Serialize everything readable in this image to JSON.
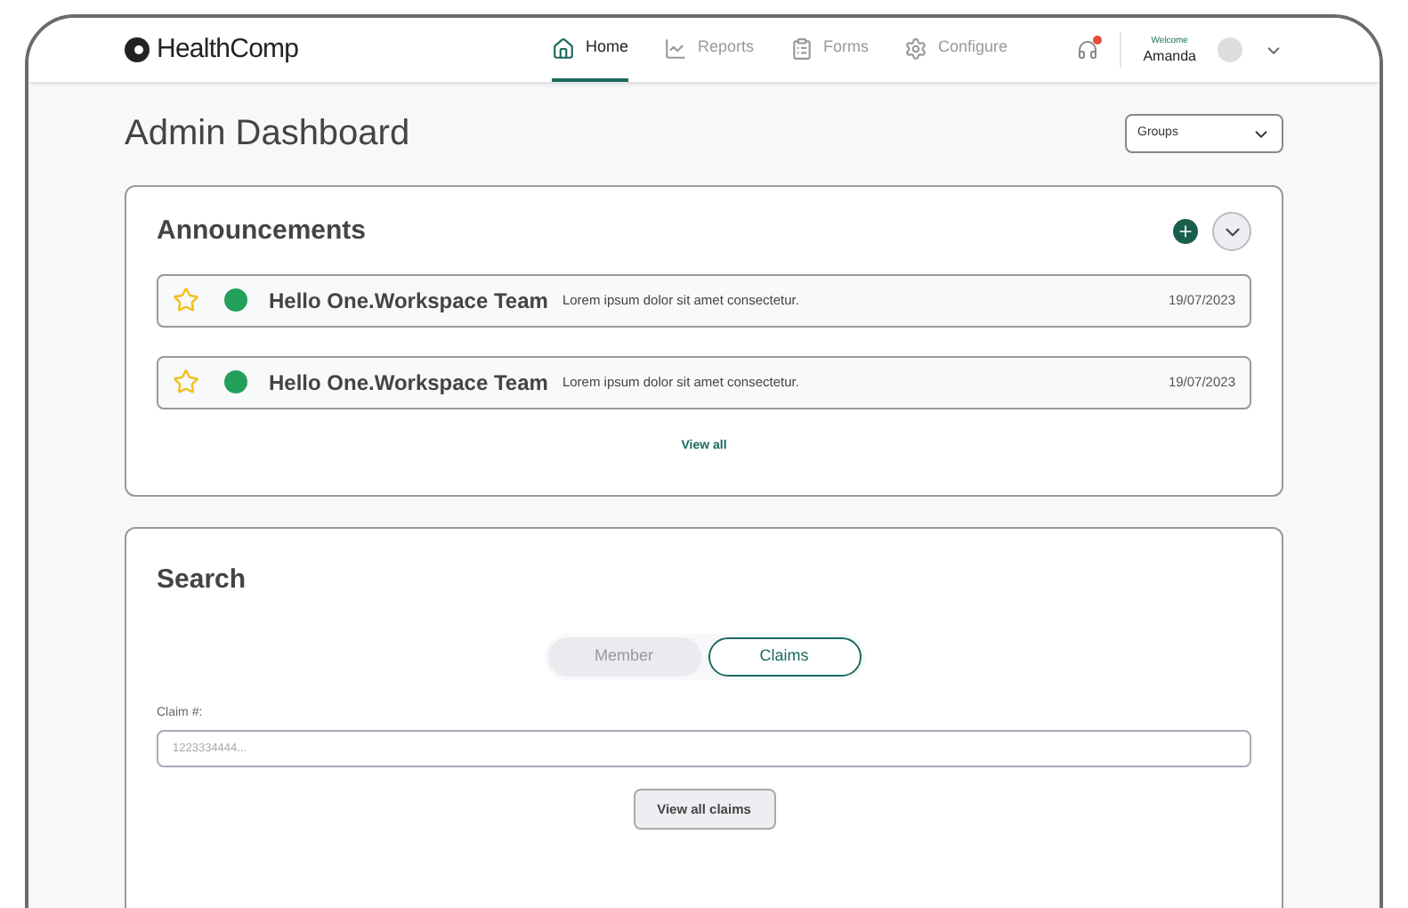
{
  "header": {
    "logo": "HealthComp",
    "nav": [
      {
        "label": "Home",
        "selected": true
      },
      {
        "label": "Reports",
        "selected": false
      },
      {
        "label": "Forms",
        "selected": false
      },
      {
        "label": "Configure",
        "selected": false
      }
    ],
    "welcome": "Welcome",
    "user": "Amanda"
  },
  "page": {
    "title": "Admin Dashboard",
    "groups_dropdown": "Groups"
  },
  "announcements": {
    "title": "Announcements",
    "items": [
      {
        "title": "Hello One.Workspace Team",
        "text": "Lorem ipsum dolor sit amet consectetur.",
        "date": "19/07/2023",
        "color": "#22a05a"
      },
      {
        "title": "Hello One.Workspace Team",
        "text": "Lorem ipsum dolor sit amet consectetur.",
        "date": "19/07/2023",
        "color": "#22a05a"
      }
    ],
    "view_all": "View all"
  },
  "search": {
    "title": "Search",
    "tabs": [
      {
        "label": "Member",
        "selected": false
      },
      {
        "label": "Claims",
        "selected": true
      }
    ],
    "field_label": "Claim #:",
    "placeholder": "1223334444...",
    "button": "View all claims"
  }
}
